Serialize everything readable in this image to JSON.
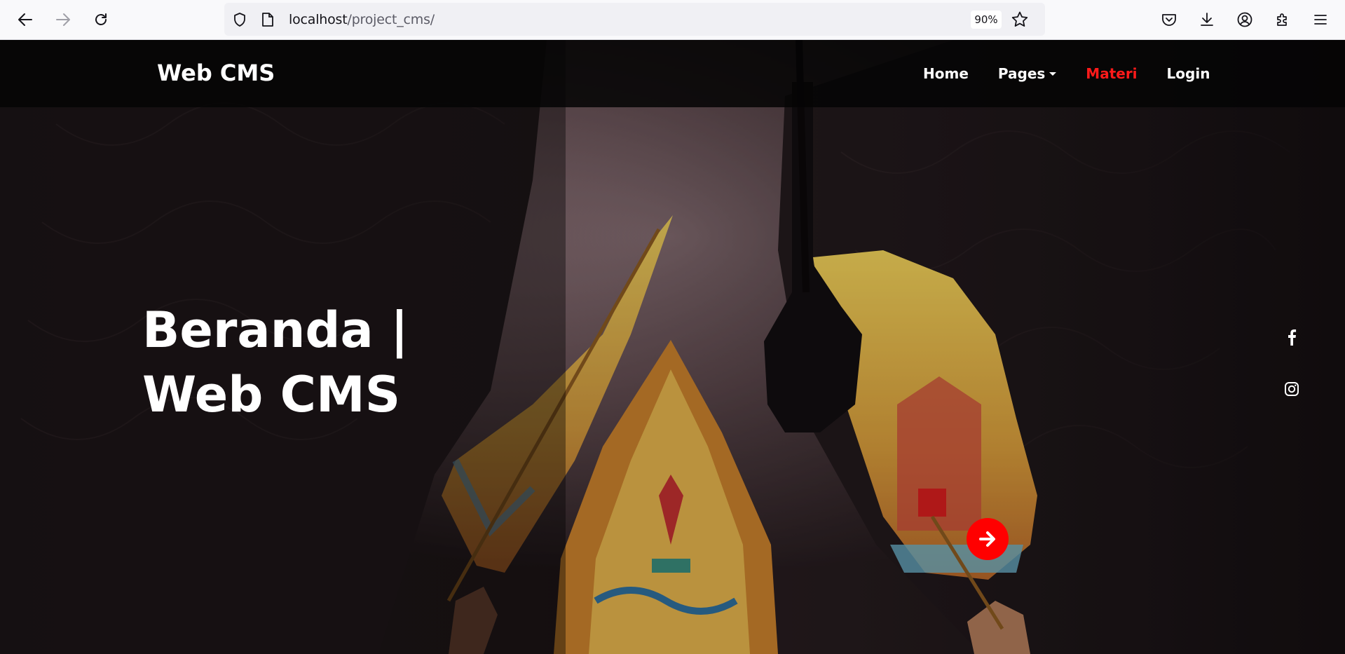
{
  "browser": {
    "url_host": "localhost",
    "url_path": "/project_cms/",
    "zoom": "90%",
    "icons": [
      "back-arrow-icon",
      "forward-arrow-icon",
      "reload-icon",
      "shield-icon",
      "page-icon",
      "bookmark-star-icon",
      "pocket-icon",
      "download-icon",
      "account-icon",
      "extensions-icon",
      "menu-icon"
    ]
  },
  "navbar": {
    "brand": "Web CMS",
    "items": [
      {
        "label": "Home",
        "active": false
      },
      {
        "label": "Pages",
        "active": false,
        "dropdown": true
      },
      {
        "label": "Materi",
        "active": true
      },
      {
        "label": "Login",
        "active": false
      }
    ],
    "active_color": "#ff1a1a"
  },
  "hero": {
    "title_line1": "Beranda |",
    "title_line2": "Web CMS",
    "social_icons": [
      "facebook-icon",
      "instagram-icon"
    ],
    "next_button_icon": "arrow-right-icon",
    "accent_color": "#ff0000"
  }
}
